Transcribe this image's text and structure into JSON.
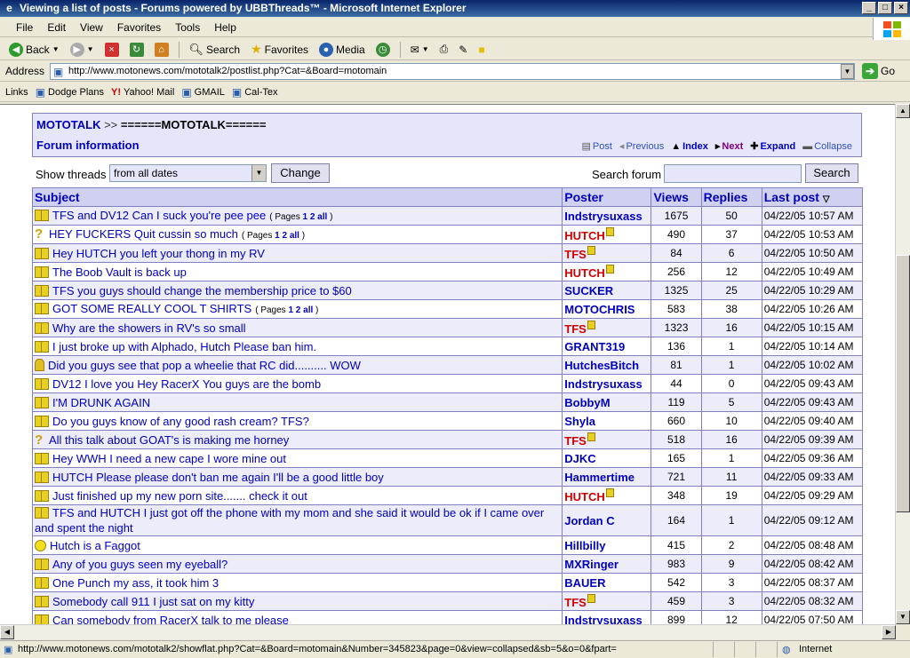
{
  "window": {
    "title": "Viewing a list of posts - Forums powered by UBBThreads™ - Microsoft Internet Explorer"
  },
  "menu": [
    "File",
    "Edit",
    "View",
    "Favorites",
    "Tools",
    "Help"
  ],
  "toolbar": {
    "back": "Back",
    "search": "Search",
    "favorites": "Favorites",
    "media": "Media"
  },
  "address": {
    "label": "Address",
    "url": "http://www.motonews.com/mototalk2/postlist.php?Cat=&Board=motomain",
    "go": "Go"
  },
  "links": {
    "label": "Links",
    "items": [
      "Dodge Plans",
      "Yahoo! Mail",
      "GMAIL",
      "Cal-Tex"
    ]
  },
  "forum": {
    "breadcrumb_root": "MOTOTALK",
    "breadcrumb_sep": ">>",
    "board_name": "======MOTOTALK======",
    "forum_info": "Forum information",
    "nav": {
      "post": "Post",
      "previous": "Previous",
      "index": "Index",
      "next": "Next",
      "expand": "Expand",
      "collapse": "Collapse"
    },
    "show_threads_label": "Show threads",
    "date_filter": "from all dates",
    "change_button": "Change",
    "search_label": "Search forum",
    "search_button": "Search",
    "columns": {
      "subject": "Subject",
      "poster": "Poster",
      "views": "Views",
      "replies": "Replies",
      "last_post": "Last post"
    },
    "rows": [
      {
        "icon": "book",
        "subject": "TFS and DV12 Can I suck you're pee pee",
        "pages": true,
        "poster": "Indstrysuxass",
        "views": "1675",
        "replies": "50",
        "last": "04/22/05 10:57 AM"
      },
      {
        "icon": "question",
        "subject": "HEY FUCKERS Quit cussin so much",
        "pages": true,
        "poster": "HUTCH",
        "views": "490",
        "replies": "37",
        "last": "04/22/05 10:53 AM"
      },
      {
        "icon": "book",
        "subject": "Hey HUTCH you left your thong in my RV",
        "pages": false,
        "poster": "TFS",
        "views": "84",
        "replies": "6",
        "last": "04/22/05 10:50 AM"
      },
      {
        "icon": "book",
        "subject": "The Boob Vault is back up",
        "pages": false,
        "poster": "HUTCH",
        "views": "256",
        "replies": "12",
        "last": "04/22/05 10:49 AM"
      },
      {
        "icon": "book",
        "subject": "TFS you guys should change the membership price to $60",
        "pages": false,
        "poster": "SUCKER",
        "views": "1325",
        "replies": "25",
        "last": "04/22/05 10:29 AM"
      },
      {
        "icon": "book",
        "subject": "GOT SOME REALLY COOL T SHIRTS",
        "pages": true,
        "poster": "MOTOCHRIS",
        "views": "583",
        "replies": "38",
        "last": "04/22/05 10:26 AM"
      },
      {
        "icon": "book",
        "subject": "Why are the showers in RV's so small",
        "pages": false,
        "poster": "TFS",
        "views": "1323",
        "replies": "16",
        "last": "04/22/05 10:15 AM"
      },
      {
        "icon": "book",
        "subject": "I just broke up with Alphado, Hutch Please ban him.",
        "pages": false,
        "poster": "GRANT319",
        "views": "136",
        "replies": "1",
        "last": "04/22/05 10:14 AM"
      },
      {
        "icon": "pin",
        "subject": "Did you guys see that pop a wheelie that RC did.......... WOW",
        "pages": false,
        "poster": "HutchesBitch",
        "views": "81",
        "replies": "1",
        "last": "04/22/05 10:02 AM"
      },
      {
        "icon": "book",
        "subject": "DV12 I love you Hey RacerX You guys are the bomb",
        "pages": false,
        "poster": "Indstrysuxass",
        "views": "44",
        "replies": "0",
        "last": "04/22/05 09:43 AM"
      },
      {
        "icon": "book",
        "subject": "I'M DRUNK AGAIN",
        "pages": false,
        "poster": "BobbyM",
        "views": "119",
        "replies": "5",
        "last": "04/22/05 09:43 AM"
      },
      {
        "icon": "book",
        "subject": "Do you guys know of any good rash cream? TFS?",
        "pages": false,
        "poster": "Shyla",
        "views": "660",
        "replies": "10",
        "last": "04/22/05 09:40 AM"
      },
      {
        "icon": "question",
        "subject": "All this talk about GOAT's is making me horney",
        "pages": false,
        "poster": "TFS",
        "views": "518",
        "replies": "16",
        "last": "04/22/05 09:39 AM"
      },
      {
        "icon": "book",
        "subject": "Hey WWH I need a new cape I wore mine out",
        "pages": false,
        "poster": "DJKC",
        "views": "165",
        "replies": "1",
        "last": "04/22/05 09:36 AM"
      },
      {
        "icon": "book",
        "subject": "HUTCH Please please don't ban me again I'll be a good little boy",
        "pages": false,
        "poster": "Hammertime",
        "views": "721",
        "replies": "11",
        "last": "04/22/05 09:33 AM"
      },
      {
        "icon": "book",
        "subject": "Just finished up my new porn site....... check it out",
        "pages": false,
        "poster": "HUTCH",
        "views": "348",
        "replies": "19",
        "last": "04/22/05 09:29 AM"
      },
      {
        "icon": "book",
        "subject": "TFS and HUTCH I just got off the phone with my mom and she said it would be ok if I came over and spent the night",
        "pages": false,
        "poster": "Jordan C",
        "views": "164",
        "replies": "1",
        "last": "04/22/05 09:12 AM"
      },
      {
        "icon": "smile",
        "subject": "Hutch is a Faggot",
        "pages": false,
        "poster": "Hillbilly",
        "views": "415",
        "replies": "2",
        "last": "04/22/05 08:48 AM"
      },
      {
        "icon": "book",
        "subject": "Any of you guys seen my eyeball?",
        "pages": false,
        "poster": "MXRinger",
        "views": "983",
        "replies": "9",
        "last": "04/22/05 08:42 AM"
      },
      {
        "icon": "book",
        "subject": "One Punch my ass, it took him 3",
        "pages": false,
        "poster": "BAUER",
        "views": "542",
        "replies": "3",
        "last": "04/22/05 08:37 AM"
      },
      {
        "icon": "book",
        "subject": "Somebody call 911 I just sat on my kitty",
        "pages": false,
        "poster": "TFS",
        "views": "459",
        "replies": "3",
        "last": "04/22/05 08:32 AM"
      },
      {
        "icon": "book",
        "subject": "Can somebody from RacerX talk to me please",
        "pages": false,
        "poster": "Indstrysuxass",
        "views": "899",
        "replies": "12",
        "last": "04/22/05 07:50 AM"
      }
    ],
    "pages_label": "Pages",
    "pages_links": [
      "1",
      "2",
      "all"
    ]
  },
  "status": {
    "url": "http://www.motonews.com/mototalk2/showflat.php?Cat=&Board=motomain&Number=345823&page=0&view=collapsed&sb=5&o=0&fpart=",
    "zone": "Internet"
  },
  "colors": {
    "accent": "#0000c0",
    "admin": "#d00000",
    "header_bg": "#d0d0f0"
  }
}
